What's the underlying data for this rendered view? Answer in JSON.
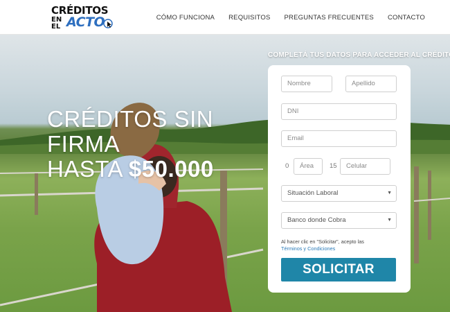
{
  "brand": {
    "logo_line1": "CRÉDITOS",
    "logo_line2": "EN EL",
    "logo_line3": "ACTO"
  },
  "nav": {
    "items": [
      "CÓMO FUNCIONA",
      "REQUISITOS",
      "PREGUNTAS FRECUENTES",
      "CONTACTO"
    ]
  },
  "hero": {
    "line1": "CRÉDITOS SIN",
    "line2": "FIRMA",
    "line3_prefix": "HASTA ",
    "amount": "$50.000"
  },
  "form": {
    "heading": "COMPLETÁ TUS DATOS PARA ACCEDER AL CRÉDITO:",
    "nombre_placeholder": "Nombre",
    "apellido_placeholder": "Apellido",
    "dni_placeholder": "DNI",
    "email_placeholder": "Email",
    "area_prefix": "0",
    "area_placeholder": "Área",
    "celular_prefix": "15",
    "celular_placeholder": "Celular",
    "situacion_selected": "Situación Laboral",
    "banco_selected": "Banco donde Cobra",
    "legal_text": "Al hacer clic en \"Solicitar\", acepto las",
    "legal_link": "Términos y Condiciones",
    "submit_label": "SOLICITAR"
  },
  "colors": {
    "accent": "#1f86a8",
    "logo_blue": "#2e6fbf",
    "link": "#2a7ab8"
  }
}
